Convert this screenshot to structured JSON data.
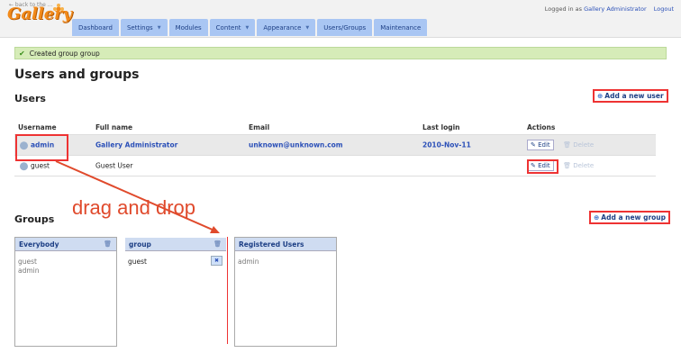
{
  "header": {
    "back_link": "← back to the ...",
    "logo": "Gallery",
    "logged_in_prefix": "Logged in as",
    "user_name": "Gallery Administrator",
    "logout": "Logout"
  },
  "nav": {
    "tabs": [
      {
        "label": "Dashboard",
        "dropdown": false
      },
      {
        "label": "Settings",
        "dropdown": true
      },
      {
        "label": "Modules",
        "dropdown": false
      },
      {
        "label": "Content",
        "dropdown": true
      },
      {
        "label": "Appearance",
        "dropdown": true
      },
      {
        "label": "Users/Groups",
        "dropdown": false
      },
      {
        "label": "Maintenance",
        "dropdown": false
      }
    ]
  },
  "message": "Created group group",
  "page_title": "Users and groups",
  "users": {
    "heading": "Users",
    "add_button": "Add a new user",
    "columns": [
      "Username",
      "Full name",
      "Email",
      "Last login",
      "Actions"
    ],
    "rows": [
      {
        "username": "admin",
        "full_name": "Gallery Administrator",
        "email": "unknown@unknown.com",
        "last_login": "2010-Nov-11",
        "edit": "Edit",
        "delete": "Delete"
      },
      {
        "username": "guest",
        "full_name": "Guest User",
        "email": "",
        "last_login": "",
        "edit": "Edit",
        "delete": "Delete"
      }
    ]
  },
  "annotation": "drag and drop",
  "groups": {
    "heading": "Groups",
    "add_button": "Add a new group",
    "boxes": [
      {
        "name": "Everybody",
        "members": [
          "guest",
          "admin"
        ]
      },
      {
        "name": "group",
        "members": [
          "guest"
        ]
      },
      {
        "name": "Registered Users",
        "members": [
          "admin"
        ]
      }
    ]
  },
  "colors": {
    "nav_tab": "#a9c6f3",
    "link": "#2b50b8",
    "highlight": "#ee3333",
    "success": "#d6ecb8"
  }
}
